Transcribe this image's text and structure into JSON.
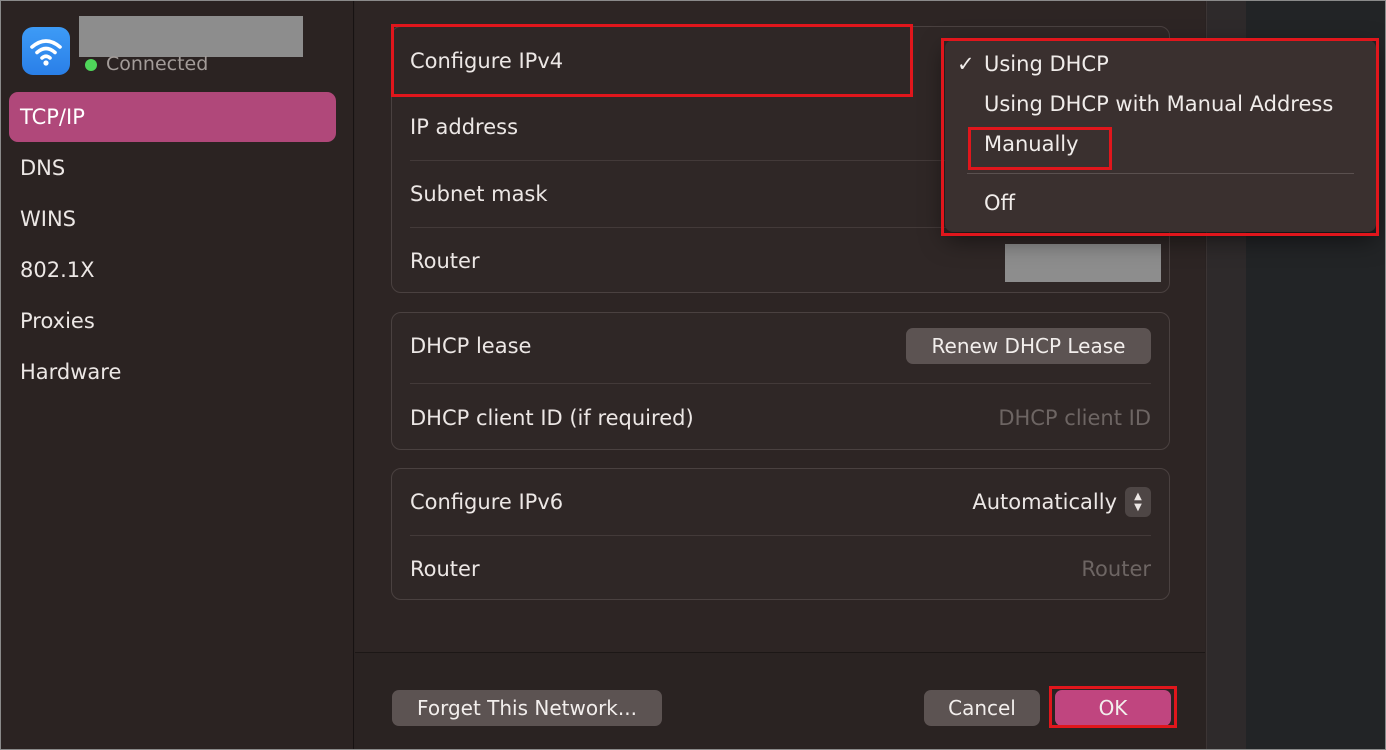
{
  "sidebar": {
    "status": "Connected",
    "items": [
      {
        "label": "TCP/IP",
        "active": true
      },
      {
        "label": "DNS"
      },
      {
        "label": "WINS"
      },
      {
        "label": "802.1X"
      },
      {
        "label": "Proxies"
      },
      {
        "label": "Hardware"
      }
    ]
  },
  "ipv4": {
    "configure_label": "Configure IPv4",
    "ip_address_label": "IP address",
    "subnet_mask_label": "Subnet mask",
    "router_label": "Router"
  },
  "dhcp": {
    "lease_label": "DHCP lease",
    "renew_button": "Renew DHCP Lease",
    "client_id_label": "DHCP client ID (if required)",
    "client_id_placeholder": "DHCP client ID"
  },
  "ipv6": {
    "configure_label": "Configure IPv6",
    "configure_value": "Automatically",
    "router_label": "Router",
    "router_placeholder": "Router"
  },
  "menu": {
    "check_glyph": "✓",
    "options": [
      "Using DHCP",
      "Using DHCP with Manual Address",
      "Manually",
      "Off"
    ],
    "selected": "Using DHCP"
  },
  "footer": {
    "forget_button": "Forget This Network...",
    "cancel_button": "Cancel",
    "ok_button": "OK"
  },
  "colors": {
    "accent": "#b0487a",
    "highlight": "#e0161c",
    "status_green": "#4fd65a"
  }
}
